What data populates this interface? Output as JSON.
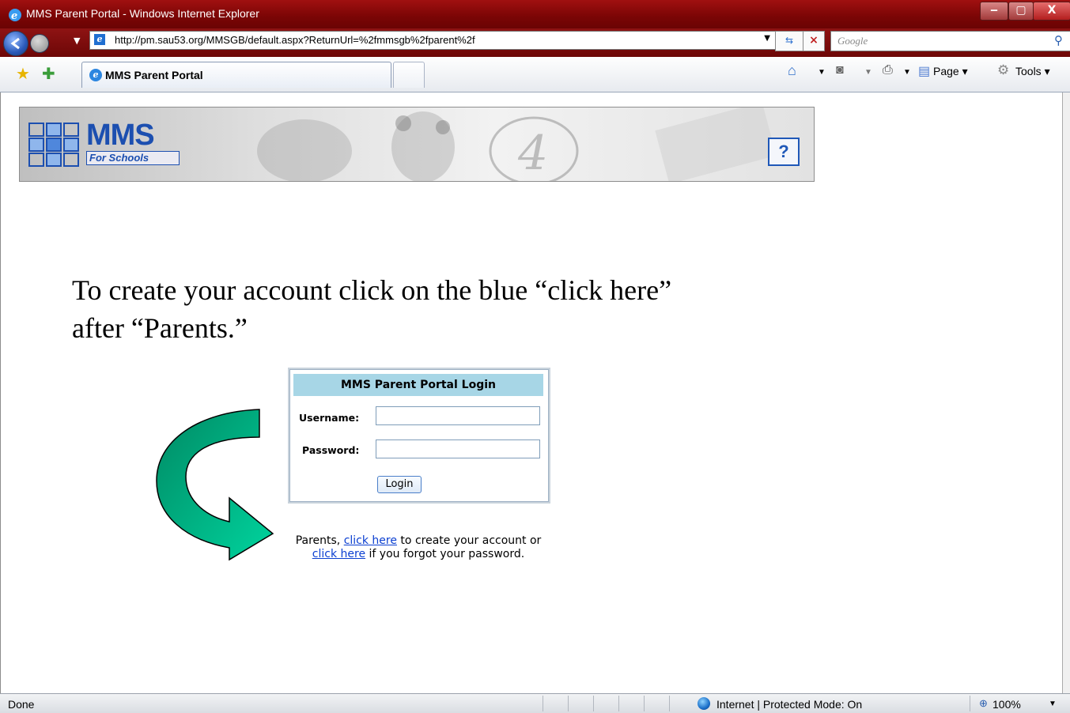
{
  "window": {
    "title": "MMS Parent Portal - Windows Internet Explorer",
    "buttons": {
      "minimize": "‒",
      "maximize": "▢",
      "close": "X"
    }
  },
  "address_bar": {
    "url": "http://pm.sau53.org/MMSGB/default.aspx?ReturnUrl=%2fmmsgb%2fparent%2f",
    "search_placeholder": "Google"
  },
  "tabs": [
    {
      "label": "MMS Parent Portal"
    }
  ],
  "command_bar": {
    "page_label": "Page ▾",
    "tools_label": "Tools ▾"
  },
  "banner": {
    "logo_text": "MMS",
    "logo_subtitle": "For Schools",
    "help_label": "?"
  },
  "instruction": {
    "line1": "To create your account click on the blue “click here”",
    "line2": "after “Parents.”"
  },
  "login": {
    "title": "MMS Parent Portal Login",
    "username_label": "Username:",
    "password_label": "Password:",
    "username_value": "",
    "password_value": "",
    "button_label": "Login"
  },
  "help_text": {
    "prefix": "Parents, ",
    "link1": "click here",
    "middle": " to create your account or",
    "link2": "click here",
    "suffix": " if you forgot your password."
  },
  "status_bar": {
    "status": "Done",
    "zone": "Internet | Protected Mode: On",
    "zoom": "100%"
  },
  "colors": {
    "titlebar": "#8b0c0c",
    "link": "#0b3fd1",
    "login_header": "#a7d6e6",
    "arrow_fill": "#00c896",
    "logo_blue": "#1c4fb0"
  }
}
